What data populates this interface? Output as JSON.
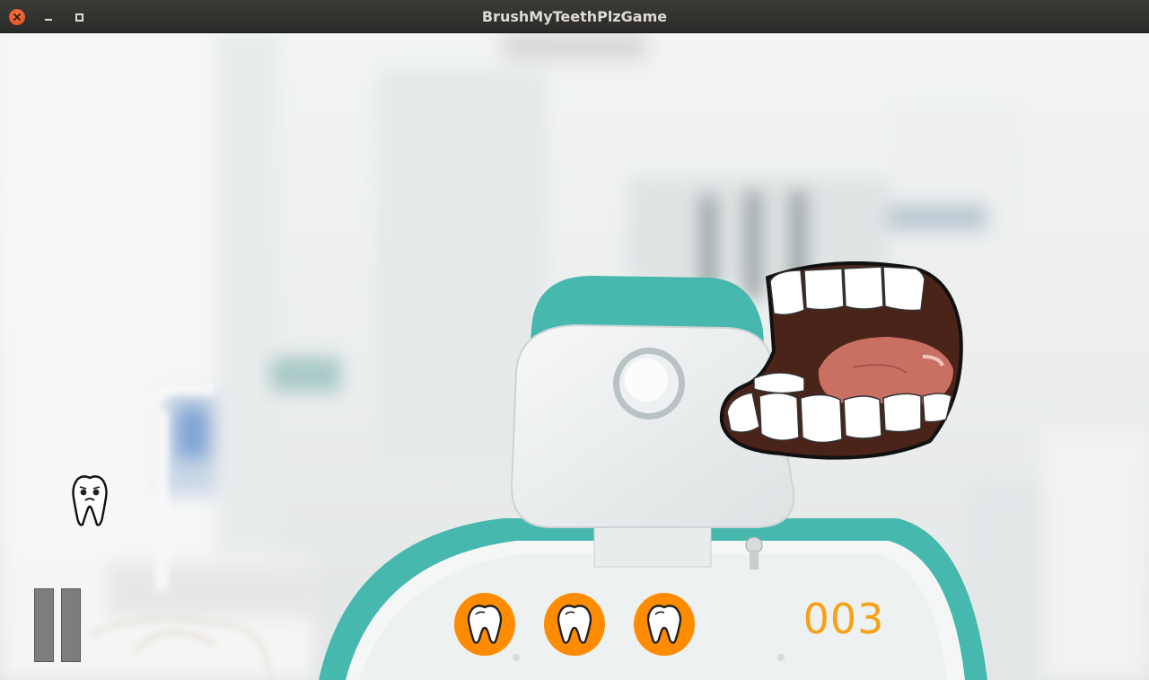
{
  "window": {
    "title": "BrushMyTeethPlzGame"
  },
  "hud": {
    "score": "003",
    "lives": [
      {
        "icon": "tooth-icon"
      },
      {
        "icon": "tooth-icon"
      },
      {
        "icon": "tooth-icon"
      }
    ],
    "pause_icon": "pause-icon"
  },
  "sprites": {
    "player": "tooth-character-icon",
    "enemy": "open-mouth-icon",
    "background": "dentist-office-background"
  },
  "colors": {
    "accent": "#ff8c00",
    "score": "#f5a218",
    "chair_teal": "#46b8ae"
  }
}
